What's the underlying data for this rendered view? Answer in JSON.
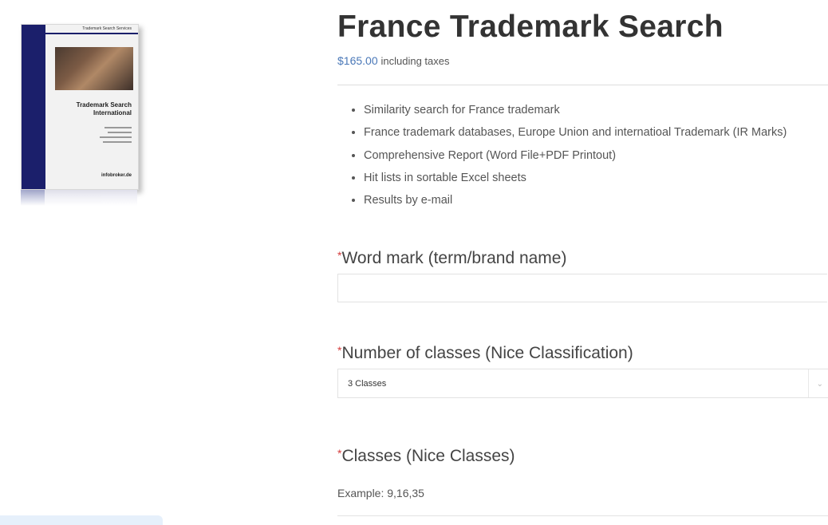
{
  "product": {
    "title": "France Trademark Search",
    "price": "$165.00",
    "price_suffix": "including taxes",
    "image": {
      "header_text": "Trademark Search Services",
      "cover_title_line1": "Trademark Search",
      "cover_title_line2": "International",
      "brand": "infobroker.de"
    },
    "features": [
      "Similarity search for France trademark",
      "France trademark databases, Europe Union and internatioal Trademark (IR Marks)",
      "Comprehensive Report (Word File+PDF Printout)",
      "Hit lists in sortable Excel sheets",
      "Results by e-mail"
    ]
  },
  "form": {
    "required_marker": "*",
    "word_mark": {
      "label": "Word mark (term/brand name)",
      "value": ""
    },
    "num_classes": {
      "label": "Number of classes (Nice Classification)",
      "selected": "3 Classes"
    },
    "classes": {
      "label": "Classes (Nice Classes)",
      "hint": "Example: 9,16,35"
    }
  },
  "colors": {
    "price": "#4a78b8",
    "required": "#d43b3b",
    "cover_blue": "#1b1f6b"
  }
}
